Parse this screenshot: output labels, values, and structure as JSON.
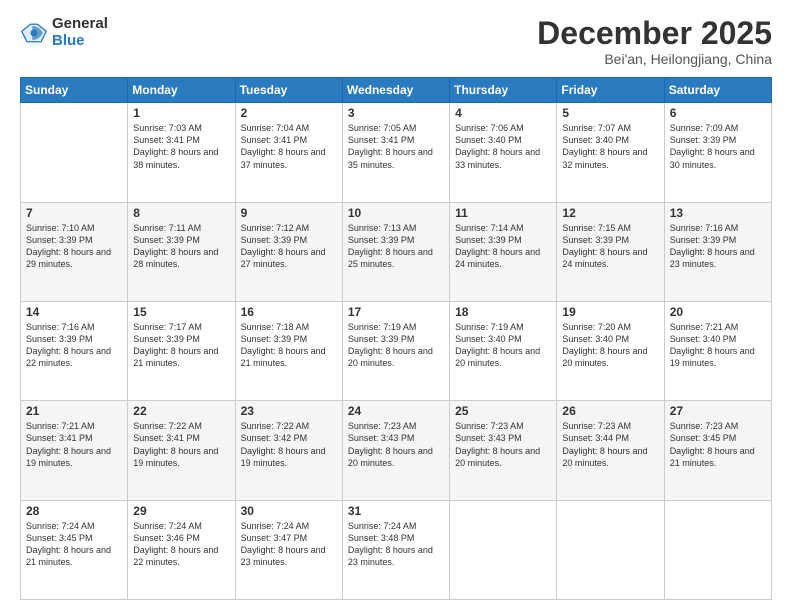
{
  "header": {
    "logo_general": "General",
    "logo_blue": "Blue",
    "month": "December 2025",
    "location": "Bei'an, Heilongjiang, China"
  },
  "weekdays": [
    "Sunday",
    "Monday",
    "Tuesday",
    "Wednesday",
    "Thursday",
    "Friday",
    "Saturday"
  ],
  "weeks": [
    [
      {
        "day": "",
        "sunrise": "",
        "sunset": "",
        "daylight": ""
      },
      {
        "day": "1",
        "sunrise": "7:03 AM",
        "sunset": "3:41 PM",
        "daylight": "8 hours and 38 minutes."
      },
      {
        "day": "2",
        "sunrise": "7:04 AM",
        "sunset": "3:41 PM",
        "daylight": "8 hours and 37 minutes."
      },
      {
        "day": "3",
        "sunrise": "7:05 AM",
        "sunset": "3:41 PM",
        "daylight": "8 hours and 35 minutes."
      },
      {
        "day": "4",
        "sunrise": "7:06 AM",
        "sunset": "3:40 PM",
        "daylight": "8 hours and 33 minutes."
      },
      {
        "day": "5",
        "sunrise": "7:07 AM",
        "sunset": "3:40 PM",
        "daylight": "8 hours and 32 minutes."
      },
      {
        "day": "6",
        "sunrise": "7:09 AM",
        "sunset": "3:39 PM",
        "daylight": "8 hours and 30 minutes."
      }
    ],
    [
      {
        "day": "7",
        "sunrise": "7:10 AM",
        "sunset": "3:39 PM",
        "daylight": "8 hours and 29 minutes."
      },
      {
        "day": "8",
        "sunrise": "7:11 AM",
        "sunset": "3:39 PM",
        "daylight": "8 hours and 28 minutes."
      },
      {
        "day": "9",
        "sunrise": "7:12 AM",
        "sunset": "3:39 PM",
        "daylight": "8 hours and 27 minutes."
      },
      {
        "day": "10",
        "sunrise": "7:13 AM",
        "sunset": "3:39 PM",
        "daylight": "8 hours and 25 minutes."
      },
      {
        "day": "11",
        "sunrise": "7:14 AM",
        "sunset": "3:39 PM",
        "daylight": "8 hours and 24 minutes."
      },
      {
        "day": "12",
        "sunrise": "7:15 AM",
        "sunset": "3:39 PM",
        "daylight": "8 hours and 24 minutes."
      },
      {
        "day": "13",
        "sunrise": "7:16 AM",
        "sunset": "3:39 PM",
        "daylight": "8 hours and 23 minutes."
      }
    ],
    [
      {
        "day": "14",
        "sunrise": "7:16 AM",
        "sunset": "3:39 PM",
        "daylight": "8 hours and 22 minutes."
      },
      {
        "day": "15",
        "sunrise": "7:17 AM",
        "sunset": "3:39 PM",
        "daylight": "8 hours and 21 minutes."
      },
      {
        "day": "16",
        "sunrise": "7:18 AM",
        "sunset": "3:39 PM",
        "daylight": "8 hours and 21 minutes."
      },
      {
        "day": "17",
        "sunrise": "7:19 AM",
        "sunset": "3:39 PM",
        "daylight": "8 hours and 20 minutes."
      },
      {
        "day": "18",
        "sunrise": "7:19 AM",
        "sunset": "3:40 PM",
        "daylight": "8 hours and 20 minutes."
      },
      {
        "day": "19",
        "sunrise": "7:20 AM",
        "sunset": "3:40 PM",
        "daylight": "8 hours and 20 minutes."
      },
      {
        "day": "20",
        "sunrise": "7:21 AM",
        "sunset": "3:40 PM",
        "daylight": "8 hours and 19 minutes."
      }
    ],
    [
      {
        "day": "21",
        "sunrise": "7:21 AM",
        "sunset": "3:41 PM",
        "daylight": "8 hours and 19 minutes."
      },
      {
        "day": "22",
        "sunrise": "7:22 AM",
        "sunset": "3:41 PM",
        "daylight": "8 hours and 19 minutes."
      },
      {
        "day": "23",
        "sunrise": "7:22 AM",
        "sunset": "3:42 PM",
        "daylight": "8 hours and 19 minutes."
      },
      {
        "day": "24",
        "sunrise": "7:23 AM",
        "sunset": "3:43 PM",
        "daylight": "8 hours and 20 minutes."
      },
      {
        "day": "25",
        "sunrise": "7:23 AM",
        "sunset": "3:43 PM",
        "daylight": "8 hours and 20 minutes."
      },
      {
        "day": "26",
        "sunrise": "7:23 AM",
        "sunset": "3:44 PM",
        "daylight": "8 hours and 20 minutes."
      },
      {
        "day": "27",
        "sunrise": "7:23 AM",
        "sunset": "3:45 PM",
        "daylight": "8 hours and 21 minutes."
      }
    ],
    [
      {
        "day": "28",
        "sunrise": "7:24 AM",
        "sunset": "3:45 PM",
        "daylight": "8 hours and 21 minutes."
      },
      {
        "day": "29",
        "sunrise": "7:24 AM",
        "sunset": "3:46 PM",
        "daylight": "8 hours and 22 minutes."
      },
      {
        "day": "30",
        "sunrise": "7:24 AM",
        "sunset": "3:47 PM",
        "daylight": "8 hours and 23 minutes."
      },
      {
        "day": "31",
        "sunrise": "7:24 AM",
        "sunset": "3:48 PM",
        "daylight": "8 hours and 23 minutes."
      },
      {
        "day": "",
        "sunrise": "",
        "sunset": "",
        "daylight": ""
      },
      {
        "day": "",
        "sunrise": "",
        "sunset": "",
        "daylight": ""
      },
      {
        "day": "",
        "sunrise": "",
        "sunset": "",
        "daylight": ""
      }
    ]
  ]
}
